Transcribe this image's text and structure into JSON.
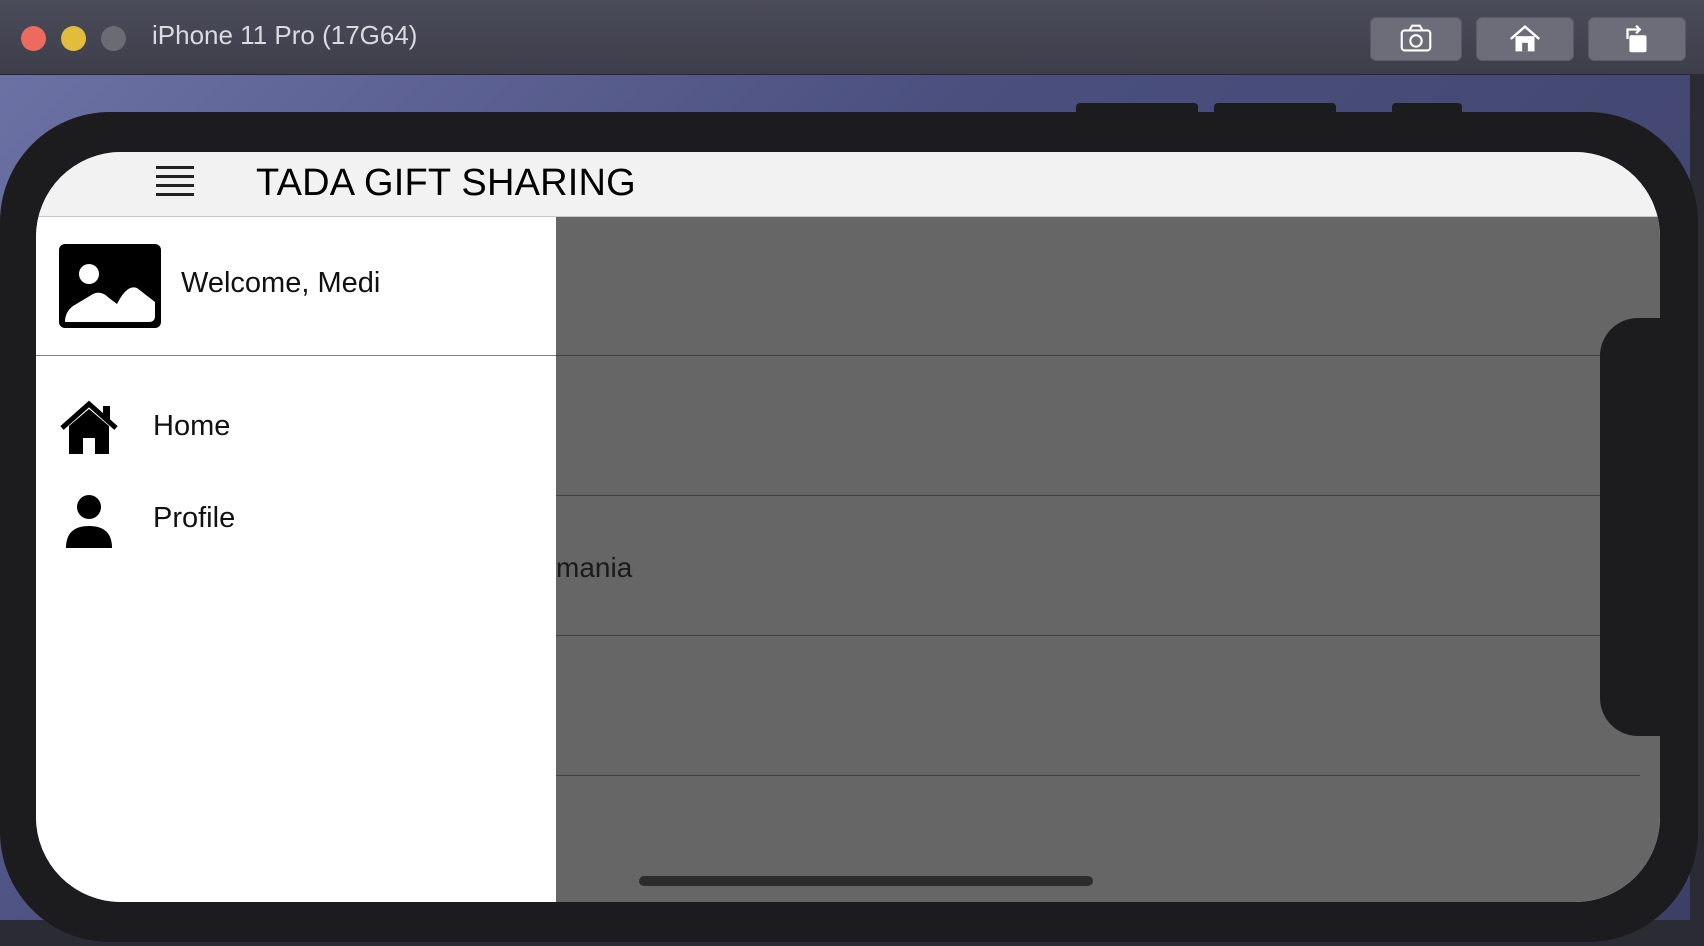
{
  "window": {
    "title": "iPhone 11 Pro (17G64)",
    "toolbar": {
      "screenshot_icon": "camera-icon",
      "home_icon": "home-icon",
      "rotate_icon": "rotate-icon"
    }
  },
  "app": {
    "title": "TADA GIFT SHARING",
    "menu_icon": "hamburger-icon"
  },
  "drawer": {
    "welcome": "Welcome, Medi",
    "avatar_icon": "image-placeholder-icon",
    "items": [
      {
        "label": "Home",
        "icon": "house-icon"
      },
      {
        "label": "Profile",
        "icon": "person-icon"
      }
    ]
  },
  "content": {
    "partial_row_text": "mania"
  },
  "colors": {
    "overlay": "#666666",
    "navbar": "#f2f2f2",
    "drawer": "#ffffff",
    "device": "#1c1c1e"
  }
}
